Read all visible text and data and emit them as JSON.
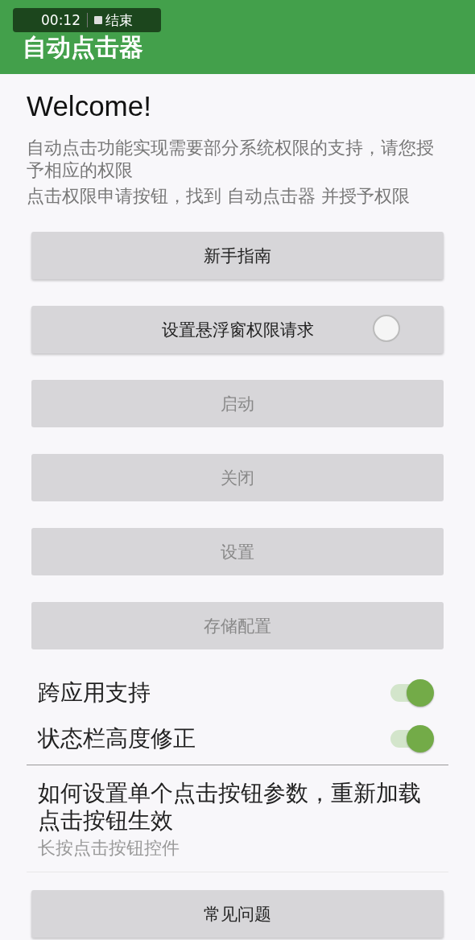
{
  "app_bar": {
    "title": "自动点击器"
  },
  "recording_overlay": {
    "time": "00:12",
    "stop_label": "结束"
  },
  "welcome": {
    "heading": "Welcome!",
    "lines": [
      "自动点击功能实现需要部分系统权限的支持，请您授予相应的权限",
      "点击权限申请按钮，找到 自动点击器 并授予权限"
    ]
  },
  "buttons": [
    {
      "label": "新手指南",
      "kind": "plain",
      "disabled": false
    },
    {
      "label": "设置悬浮窗权限请求",
      "kind": "radio",
      "disabled": false,
      "checked": false
    },
    {
      "label": "启动",
      "kind": "plain",
      "disabled": true
    },
    {
      "label": "关闭",
      "kind": "plain",
      "disabled": true
    },
    {
      "label": "设置",
      "kind": "plain",
      "disabled": true
    },
    {
      "label": "存储配置",
      "kind": "plain",
      "disabled": true
    }
  ],
  "switches": [
    {
      "label": "跨应用支持",
      "on": true
    },
    {
      "label": "状态栏高度修正",
      "on": true
    }
  ],
  "help": {
    "title": "如何设置单个点击按钮参数，重新加载点击按钮生效",
    "subtitle": "长按点击按钮控件"
  },
  "faq_button": {
    "label": "常见问题",
    "disabled": false
  }
}
